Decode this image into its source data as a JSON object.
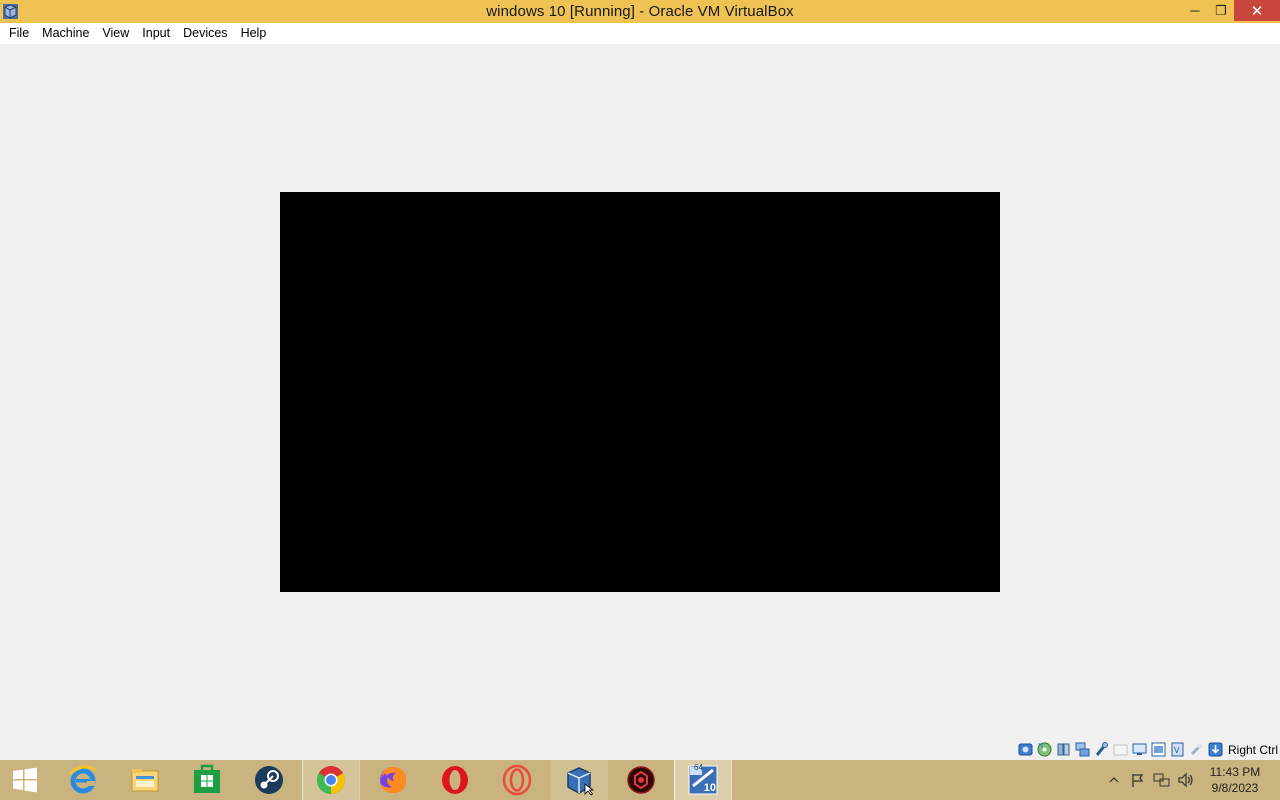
{
  "window": {
    "title": "windows 10 [Running] - Oracle VM VirtualBox",
    "icon": "virtualbox-icon",
    "controls": {
      "minimize": "─",
      "restore": "❐",
      "close": "✕"
    }
  },
  "menubar": {
    "items": [
      "File",
      "Machine",
      "View",
      "Input",
      "Devices",
      "Help"
    ]
  },
  "statusbar": {
    "icons": [
      "hard-disk-icon",
      "optical-drive-icon",
      "audio-icon",
      "network-icon",
      "usb-icon",
      "shared-folders-icon",
      "display-icon",
      "video-capture-icon",
      "cpu-icon",
      "mouse-integration-icon",
      "keyboard-capture-icon"
    ],
    "host_key": "Right Ctrl"
  },
  "taskbar": {
    "apps": [
      {
        "name": "internet-explorer-icon"
      },
      {
        "name": "file-explorer-icon"
      },
      {
        "name": "store-icon"
      },
      {
        "name": "steam-icon"
      },
      {
        "name": "chrome-icon"
      },
      {
        "name": "firefox-icon"
      },
      {
        "name": "opera-icon"
      },
      {
        "name": "opera-gx-icon"
      },
      {
        "name": "virtualbox-icon"
      },
      {
        "name": "game-icon"
      },
      {
        "name": "virtualbox-vm-icon",
        "badge": "10",
        "badge_top": "64"
      }
    ],
    "clock": {
      "time": "11:43 PM",
      "date": "9/8/2023"
    }
  },
  "colors": {
    "titlebar": "#eec253",
    "taskbar": "#c9b37e",
    "close_button": "#c9463d",
    "vm_screen": "#000000"
  }
}
